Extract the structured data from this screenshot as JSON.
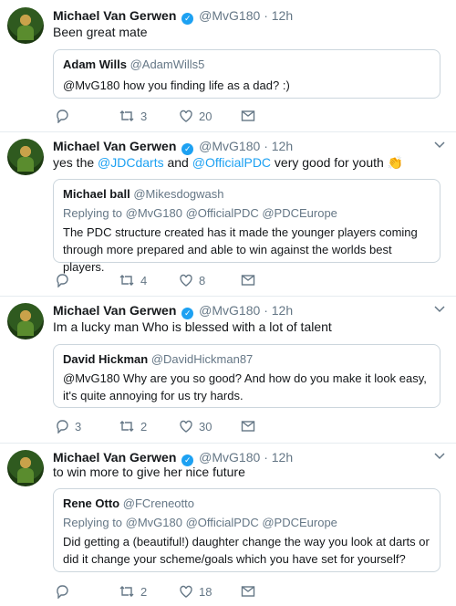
{
  "colors": {
    "accent": "#1da1f2",
    "muted": "#657786",
    "border": "#ccd6dd"
  },
  "tweets": [
    {
      "author": "Michael Van Gerwen",
      "handle": "@MvG180",
      "time": "12h",
      "text": "Been great mate",
      "quote": {
        "name": "Adam Wills",
        "handle": "@AdamWills5",
        "replying": "",
        "text": "@MvG180 how you finding life as a dad? :)"
      },
      "replies": "",
      "retweets": "3",
      "likes": "20"
    },
    {
      "author": "Michael Van Gerwen",
      "handle": "@MvG180",
      "time": "12h",
      "text_pre": "yes the ",
      "mention1": "@JDCdarts",
      "text_mid": " and ",
      "mention2": "@OfficialPDC",
      "text_post": " very good for youth 👏",
      "quote": {
        "name": "Michael ball",
        "handle": "@Mikesdogwash",
        "replying": "Replying to @MvG180 @OfficialPDC @PDCEurope",
        "text": "The PDC structure created has it made the younger players coming through more prepared and able to win against the worlds best players."
      },
      "replies": "",
      "retweets": "4",
      "likes": "8"
    },
    {
      "author": "Michael Van Gerwen",
      "handle": "@MvG180",
      "time": "12h",
      "text": "Im a lucky man Who is blessed with a lot of talent",
      "quote": {
        "name": "David Hickman",
        "handle": "@DavidHickman87",
        "replying": "",
        "text": "@MvG180 Why are you so good? And how do you make it look easy, it's quite annoying for us try hards."
      },
      "replies": "3",
      "retweets": "2",
      "likes": "30"
    },
    {
      "author": "Michael Van Gerwen",
      "handle": "@MvG180",
      "time": "12h",
      "text": "to win more to give her nice future",
      "quote": {
        "name": "Rene Otto",
        "handle": "@FCreneotto",
        "replying": "Replying to @MvG180 @OfficialPDC @PDCEurope",
        "text": "Did getting a (beautiful!) daughter change the way you look at darts or did it change your scheme/goals which you have set for yourself?"
      },
      "replies": "",
      "retweets": "2",
      "likes": "18"
    }
  ],
  "icons": [
    "reply-icon",
    "retweet-icon",
    "like-icon",
    "message-icon",
    "verified-icon",
    "caret-down-icon"
  ]
}
